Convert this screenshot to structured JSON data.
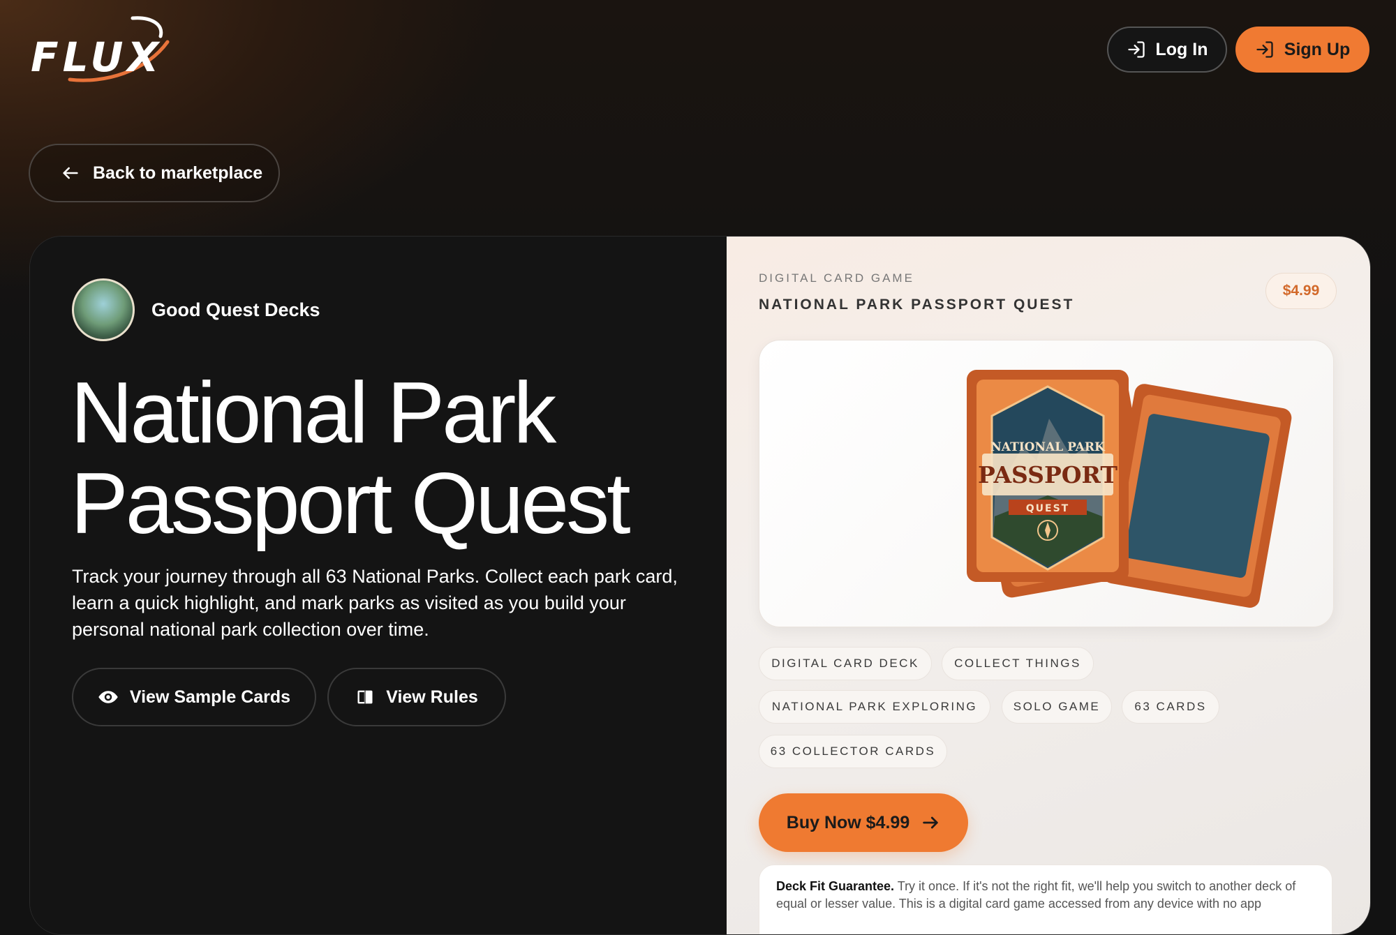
{
  "brand": {
    "logo_text": "FLUX"
  },
  "header": {
    "login_label": "Log In",
    "signup_label": "Sign Up"
  },
  "nav": {
    "back_label": "Back to marketplace"
  },
  "seller": {
    "name": "Good Quest Decks"
  },
  "product": {
    "title_line1": "National Park",
    "title_line2": "Passport Quest",
    "description": "Track your journey through all 63 National Parks. Collect each park card, learn a quick highlight, and mark parks as visited as you build your personal national park collection over time.",
    "view_samples_label": "View Sample Cards",
    "view_rules_label": "View Rules",
    "category": "DIGITAL CARD GAME",
    "name_caps": "NATIONAL PARK PASSPORT QUEST",
    "price": "$4.99",
    "cover_text": {
      "line1": "NATIONAL PARK",
      "line2": "PASSPORT",
      "line3": "QUEST"
    },
    "tags": [
      "DIGITAL CARD DECK",
      "COLLECT THINGS",
      "NATIONAL PARK EXPLORING",
      "SOLO GAME",
      "63 CARDS",
      "63 COLLECTOR CARDS"
    ],
    "buy_label": "Buy Now $4.99",
    "guarantee_title": "Deck Fit Guarantee.",
    "guarantee_text": " Try it once. If it's not the right fit, we'll help you switch to another deck of equal or lesser value. This is a digital card game accessed from any device with no app"
  },
  "colors": {
    "accent": "#f07a32",
    "price": "#d2692a",
    "dark_bg": "#141414",
    "light_panel": "#f3efec"
  },
  "icons": [
    "log-in-icon",
    "arrow-left-icon",
    "eye-icon",
    "book-icon",
    "arrow-right-icon"
  ]
}
